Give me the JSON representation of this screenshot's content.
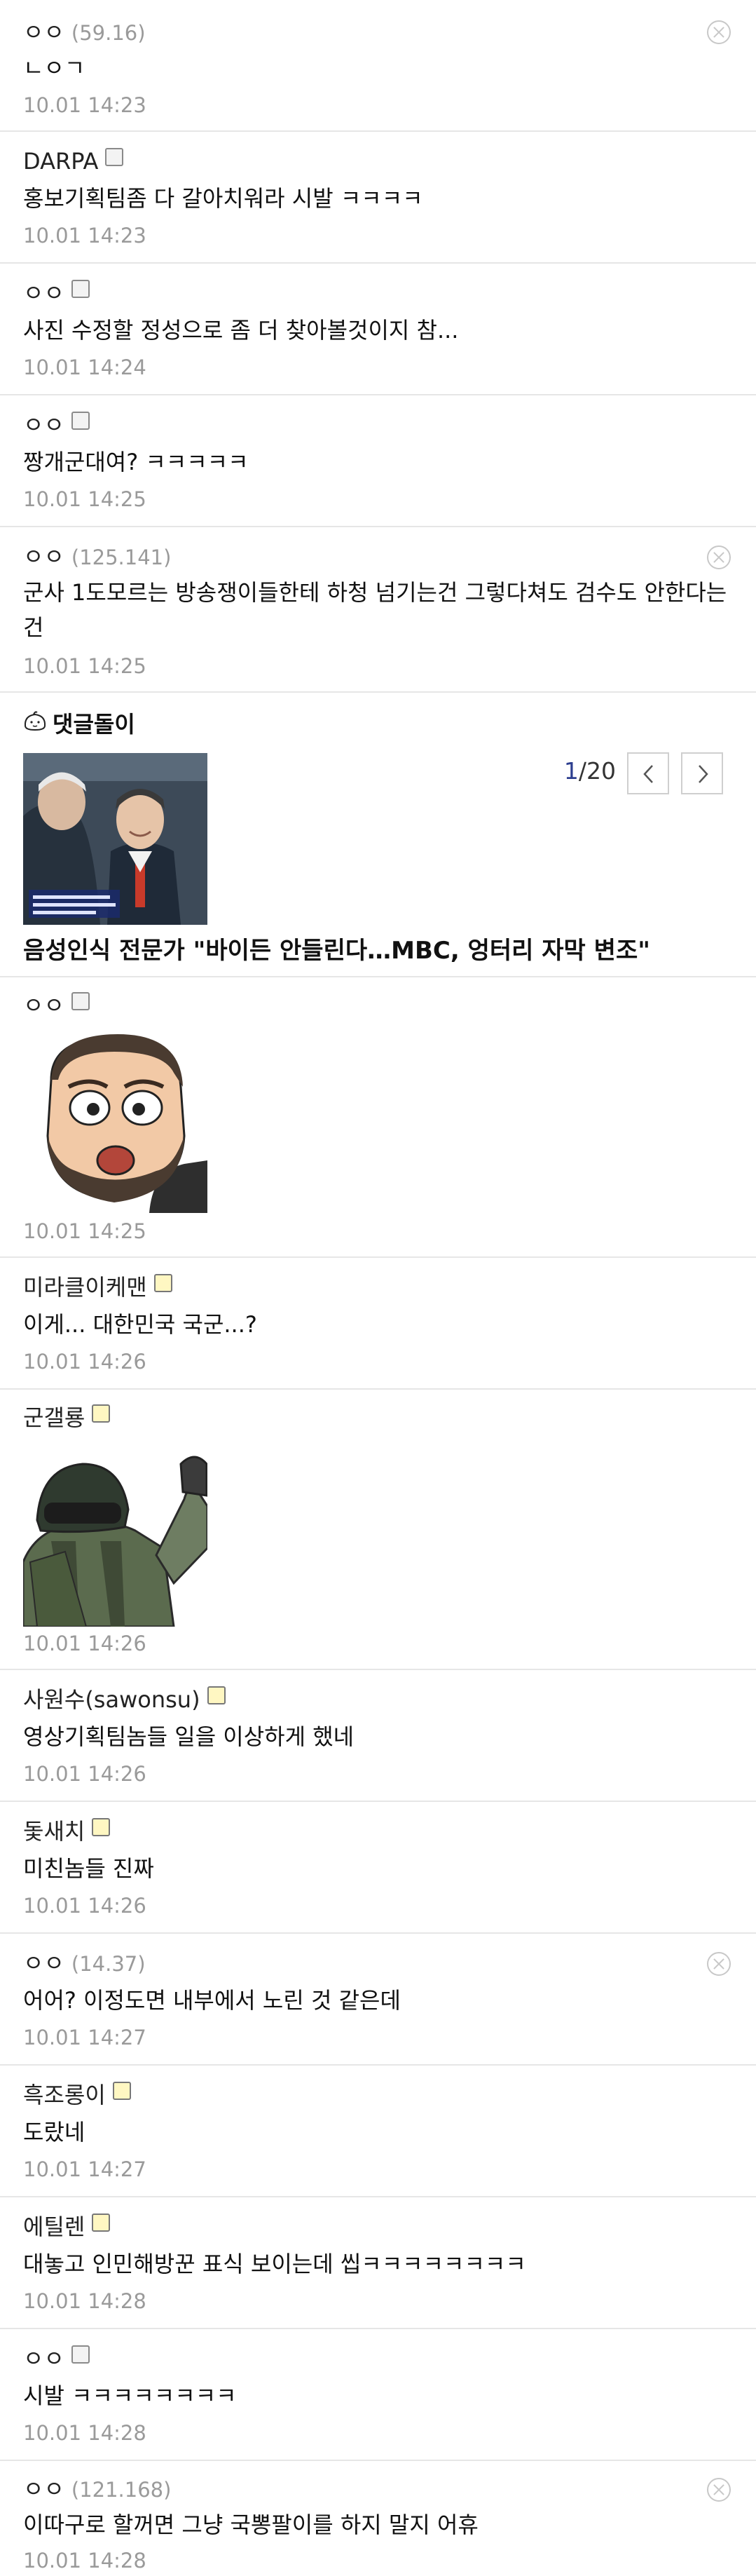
{
  "comments": [
    {
      "nick": "ㅇㅇ",
      "ip": "(59.16)",
      "text": "ㄴㅇㄱ",
      "date": "10.01 14:23"
    },
    {
      "nick": "DARPA",
      "text": "홍보기획팀좀 다 갈아치워라 시발 ㅋㅋㅋㅋ",
      "date": "10.01 14:23"
    },
    {
      "nick": "ㅇㅇ",
      "text": "사진 수정할 정성으로 좀 더 찾아볼것이지 참...",
      "date": "10.01 14:24"
    },
    {
      "nick": "ㅇㅇ",
      "text": "짱개군대여? ㅋㅋㅋㅋㅋ",
      "date": "10.01 14:25"
    },
    {
      "nick": "ㅇㅇ",
      "ip": "(125.141)",
      "text_line1": "군사 1도모르는 방송쟁이들한테 하청 넘기는건 그렇다쳐도 검수도 안한다는",
      "text_line2": "건",
      "date": "10.01 14:25"
    },
    {
      "nick": "ㅇㅇ",
      "date": "10.01 14:25"
    },
    {
      "nick": "미라클이케맨",
      "text": "이게... 대한민국 국군...?",
      "date": "10.01 14:26"
    },
    {
      "nick": "군갤룡",
      "date": "10.01 14:26"
    },
    {
      "nick": "사원수(sawonsu)",
      "text": "영상기획팀놈들 일을 이상하게 했네",
      "date": "10.01 14:26"
    },
    {
      "nick": "돛새치",
      "text": "미친놈들 진짜",
      "date": "10.01 14:26"
    },
    {
      "nick": "ㅇㅇ",
      "ip": "(14.37)",
      "text": "어어? 이정도면 내부에서 노린 것 같은데",
      "date": "10.01 14:27"
    },
    {
      "nick": "흑조롱이",
      "text": "도랐네",
      "date": "10.01 14:27"
    },
    {
      "nick": "에틸렌",
      "text": "대놓고 인민해방꾼 표식 보이는데 씹ㅋㅋㅋㅋㅋㅋㅋㅋ",
      "date": "10.01 14:28"
    },
    {
      "nick": "ㅇㅇ",
      "text": "시발 ㅋㅋㅋㅋㅋㅋㅋㅋ",
      "date": "10.01 14:28"
    },
    {
      "nick": "ㅇㅇ",
      "ip": "(121.168)",
      "text": "이따구로 할꺼면 그냥 국뽕팔이를 하지 말지 어휴",
      "date": "10.01 14:28"
    }
  ],
  "dat_gul_dol_i": {
    "title": "댓글돌이",
    "pager_current": "1",
    "pager_total": "/20",
    "headline": "음성인식 전문가 \"바이든 안들린다…MBC, 엉터리 자막 변조\""
  },
  "icons": [
    "delete-icon",
    "gallog-icon",
    "chevron-left-icon",
    "chevron-right-icon",
    "dat-gul-dol-i-icon"
  ],
  "colors": {
    "text": "#222222",
    "meta": "#9a9a9a",
    "divider": "#e6e6e6",
    "pager_accent": "#2d3e8f"
  }
}
